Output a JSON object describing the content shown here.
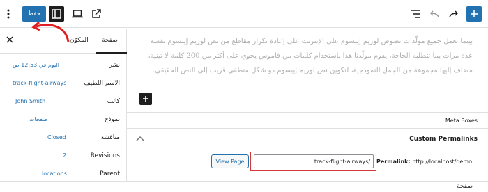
{
  "toolbar": {
    "save_label": "حفظ",
    "icons": {
      "options": "kebab-vertical-icon",
      "settings": "sidebar-toggle-icon",
      "preview": "desktop-preview-icon",
      "view": "external-link-icon",
      "list_view": "list-view-icon",
      "undo": "undo-icon",
      "redo": "redo-icon",
      "inserter": "plus-icon"
    }
  },
  "sidebar": {
    "tabs": [
      {
        "label": "صفحة",
        "active": true
      },
      {
        "label": "المكوّن",
        "active": false
      }
    ],
    "rows": [
      {
        "label": "نشر",
        "value": "اليوم في 12:53 ص"
      },
      {
        "label": "الاسم اللطيف",
        "value": "track-flight-airways"
      },
      {
        "label": "كاتب",
        "value": "John Smith"
      },
      {
        "label": "نموذج",
        "value": "صفحات"
      },
      {
        "label": "مناقشة",
        "value": "Closed"
      },
      {
        "label": "Revisions",
        "value": "2"
      },
      {
        "label": "Parent",
        "value": "locations"
      }
    ]
  },
  "content": {
    "paragraph": "بينما تعمل جميع مولّدات نصوص لوريم إيبسوم على الإنترنت على إعادة تكرار مقاطع من نص لوريم إيبسوم نفسه عدة مرات بما تتطلبه الحاجة، يقوم مولّدنا هذا باستخدام كلمات من قاموس يحوي على أكثر من 200 كلمة لا تينية، مضاف إليها مجموعة من الجمل النموذجية، لتكوين نص لوريم إيبسوم ذو شكل منطقي قريب إلى النص الحقيقي."
  },
  "meta_boxes": {
    "title": "Meta Boxes",
    "permalinks": {
      "title": "Custom Permalinks",
      "label": "Permalink:",
      "base_url": "http://localhost/demo",
      "slug_value": "track-flight-airways/",
      "view_button": "View Page"
    }
  },
  "footer": {
    "breadcrumb": "صفحة"
  },
  "colors": {
    "accent": "#2271b1",
    "highlight": "#d63638",
    "annotation_arrow": "#e02020"
  }
}
